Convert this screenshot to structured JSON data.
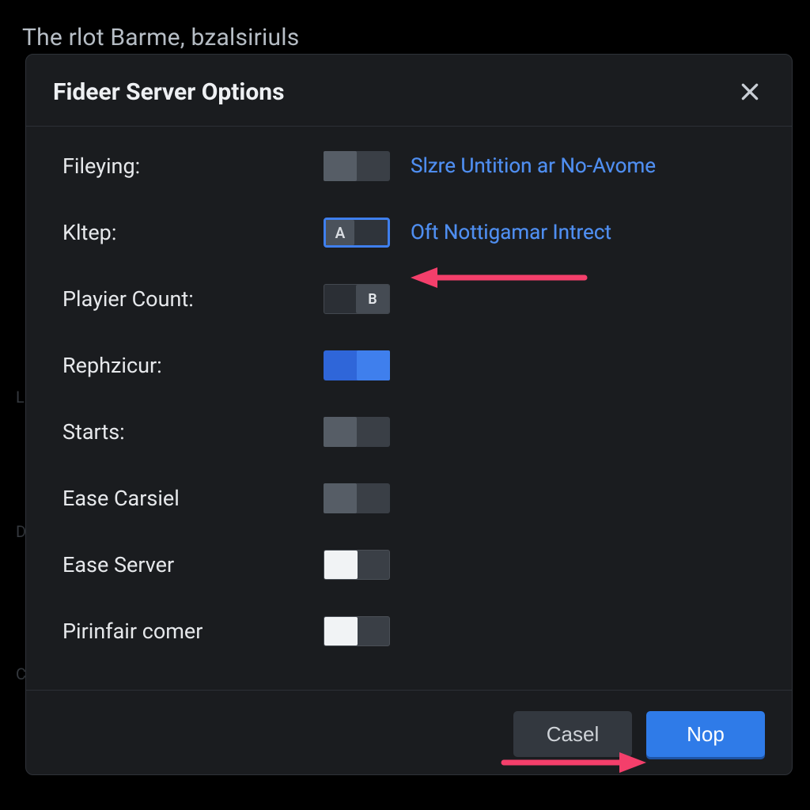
{
  "backdrop_title": "The rlot Barme, bzalsiriuls",
  "dialog": {
    "title": "Fideer Server Options",
    "rows": [
      {
        "label": "Fileying:",
        "toggle": {
          "style": "grey-left",
          "text": ""
        },
        "link": "Slzre Untition ar No-Avome"
      },
      {
        "label": "Kltep:",
        "toggle": {
          "style": "sel",
          "text": "A"
        },
        "link": "Oft Nottigamar Intrect"
      },
      {
        "label": "Playier Count:",
        "toggle": {
          "style": "grey-right",
          "text": "B"
        },
        "link": ""
      },
      {
        "label": "Rephzicur:",
        "toggle": {
          "style": "blue",
          "text": ""
        },
        "link": ""
      },
      {
        "label": "Starts:",
        "toggle": {
          "style": "grey-left2",
          "text": ""
        },
        "link": ""
      },
      {
        "label": "Ease Carsiel",
        "toggle": {
          "style": "grey-left2",
          "text": ""
        },
        "link": ""
      },
      {
        "label": "Ease Server",
        "toggle": {
          "style": "white-left",
          "text": ""
        },
        "link": ""
      },
      {
        "label": "Pirinfair comer",
        "toggle": {
          "style": "white-left",
          "text": ""
        },
        "link": ""
      }
    ],
    "footer": {
      "cancel_label": "Casel",
      "ok_label": "Nop"
    }
  },
  "colors": {
    "accent": "#3f7fed",
    "arrow": "#f43f6b"
  }
}
